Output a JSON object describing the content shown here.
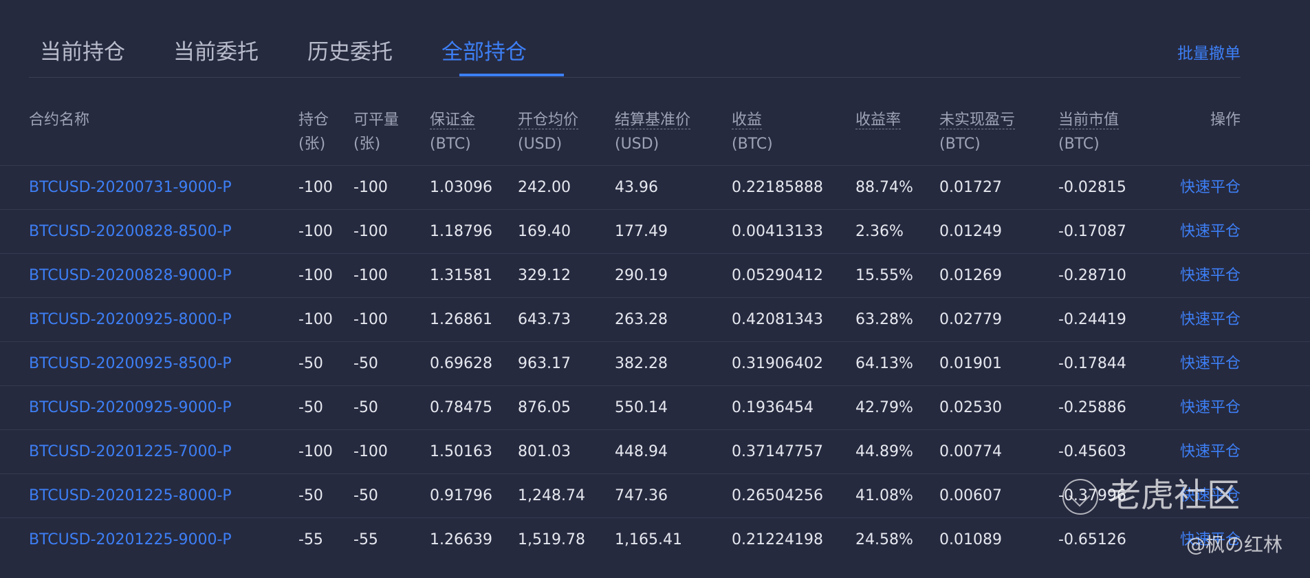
{
  "tabs": [
    {
      "label": "当前持仓",
      "active": false
    },
    {
      "label": "当前委托",
      "active": false
    },
    {
      "label": "历史委托",
      "active": false
    },
    {
      "label": "全部持仓",
      "active": true
    }
  ],
  "batch_cancel_label": "批量撤单",
  "table": {
    "headers": [
      {
        "label": "合约名称",
        "unit": ""
      },
      {
        "label": "持仓",
        "unit": "(张)"
      },
      {
        "label": "可平量",
        "unit": "(张)"
      },
      {
        "label": "保证金",
        "unit": "(BTC)"
      },
      {
        "label": "开仓均价",
        "unit": "(USD)"
      },
      {
        "label": "结算基准价",
        "unit": "(USD)"
      },
      {
        "label": "收益",
        "unit": "(BTC)"
      },
      {
        "label": "收益率",
        "unit": ""
      },
      {
        "label": "未实现盈亏",
        "unit": "(BTC)"
      },
      {
        "label": "当前市值",
        "unit": "(BTC)"
      },
      {
        "label": "操作",
        "unit": ""
      }
    ],
    "rows": [
      {
        "contract": "BTCUSD-20200731-9000-P",
        "position": "-100",
        "closable": "-100",
        "margin": "1.03096",
        "open_avg": "242.00",
        "settle_ref": "43.96",
        "pnl": "0.22185888",
        "pnl_rate": "88.74%",
        "unrealized": "0.01727",
        "market_value": "-0.02815",
        "action": "快速平仓"
      },
      {
        "contract": "BTCUSD-20200828-8500-P",
        "position": "-100",
        "closable": "-100",
        "margin": "1.18796",
        "open_avg": "169.40",
        "settle_ref": "177.49",
        "pnl": "0.00413133",
        "pnl_rate": "2.36%",
        "unrealized": "0.01249",
        "market_value": "-0.17087",
        "action": "快速平仓"
      },
      {
        "contract": "BTCUSD-20200828-9000-P",
        "position": "-100",
        "closable": "-100",
        "margin": "1.31581",
        "open_avg": "329.12",
        "settle_ref": "290.19",
        "pnl": "0.05290412",
        "pnl_rate": "15.55%",
        "unrealized": "0.01269",
        "market_value": "-0.28710",
        "action": "快速平仓"
      },
      {
        "contract": "BTCUSD-20200925-8000-P",
        "position": "-100",
        "closable": "-100",
        "margin": "1.26861",
        "open_avg": "643.73",
        "settle_ref": "263.28",
        "pnl": "0.42081343",
        "pnl_rate": "63.28%",
        "unrealized": "0.02779",
        "market_value": "-0.24419",
        "action": "快速平仓"
      },
      {
        "contract": "BTCUSD-20200925-8500-P",
        "position": "-50",
        "closable": "-50",
        "margin": "0.69628",
        "open_avg": "963.17",
        "settle_ref": "382.28",
        "pnl": "0.31906402",
        "pnl_rate": "64.13%",
        "unrealized": "0.01901",
        "market_value": "-0.17844",
        "action": "快速平仓"
      },
      {
        "contract": "BTCUSD-20200925-9000-P",
        "position": "-50",
        "closable": "-50",
        "margin": "0.78475",
        "open_avg": "876.05",
        "settle_ref": "550.14",
        "pnl": "0.1936454",
        "pnl_rate": "42.79%",
        "unrealized": "0.02530",
        "market_value": "-0.25886",
        "action": "快速平仓"
      },
      {
        "contract": "BTCUSD-20201225-7000-P",
        "position": "-100",
        "closable": "-100",
        "margin": "1.50163",
        "open_avg": "801.03",
        "settle_ref": "448.94",
        "pnl": "0.37147757",
        "pnl_rate": "44.89%",
        "unrealized": "0.00774",
        "market_value": "-0.45603",
        "action": "快速平仓"
      },
      {
        "contract": "BTCUSD-20201225-8000-P",
        "position": "-50",
        "closable": "-50",
        "margin": "0.91796",
        "open_avg": "1,248.74",
        "settle_ref": "747.36",
        "pnl": "0.26504256",
        "pnl_rate": "41.08%",
        "unrealized": "0.00607",
        "market_value": "-0.37996",
        "action": "快速平仓"
      },
      {
        "contract": "BTCUSD-20201225-9000-P",
        "position": "-55",
        "closable": "-55",
        "margin": "1.26639",
        "open_avg": "1,519.78",
        "settle_ref": "1,165.41",
        "pnl": "0.21224198",
        "pnl_rate": "24.58%",
        "unrealized": "0.01089",
        "market_value": "-0.65126",
        "action": "快速平仓"
      }
    ]
  },
  "watermark": {
    "title": "老虎社区",
    "author": "@枫の红林",
    "icon": "tiger-community-logo-icon"
  },
  "colors": {
    "background": "#262a3f",
    "accent": "#3d7ff5",
    "text": "#e6e8ef",
    "muted": "#9ea3b5"
  }
}
